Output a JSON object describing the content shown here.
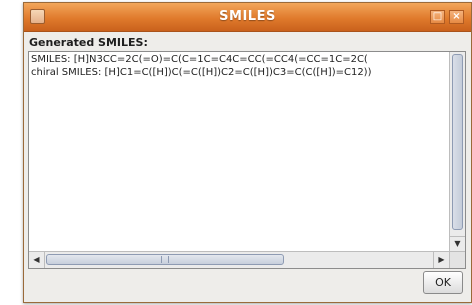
{
  "window": {
    "title": "SMILES",
    "maximize_glyph": "□",
    "close_glyph": "×"
  },
  "heading": "Generated SMILES:",
  "text_lines": [
    "SMILES: [H]N3CC=2C(=O)=C(C=1C=C4C=CC(=CC4(=CC=1C=2C(",
    "chiral SMILES: [H]C1=C([H])C(=C([H])C2=C([H])C3=C(C([H])=C12))"
  ],
  "scroll": {
    "left_arrow": "◀",
    "right_arrow": "▶",
    "down_arrow": "▼"
  },
  "buttons": {
    "ok": "OK"
  },
  "colors": {
    "titlebar": "#e07a2c",
    "window_bg": "#eeedea",
    "text_bg": "#ffffff"
  }
}
